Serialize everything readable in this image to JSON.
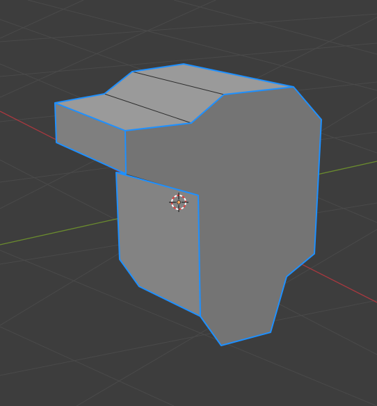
{
  "viewport": {
    "view": "3d-viewport",
    "background_color": "#3d3d3d",
    "grid_color": "#4a4a4a",
    "x_axis_color": "#a8383f",
    "y_axis_color": "#6b8c2e"
  },
  "selected_object": {
    "kind": "mesh",
    "selected": true,
    "outline_color": "#1e90ff",
    "face_colors": {
      "top": "#9a9a9a",
      "front": "#7d7d7d",
      "right": "#747474",
      "lower": "#838383"
    }
  },
  "cursor_3d": {
    "kind": "3d-cursor",
    "ring_colors": [
      "#e04040",
      "#ffffff"
    ]
  }
}
